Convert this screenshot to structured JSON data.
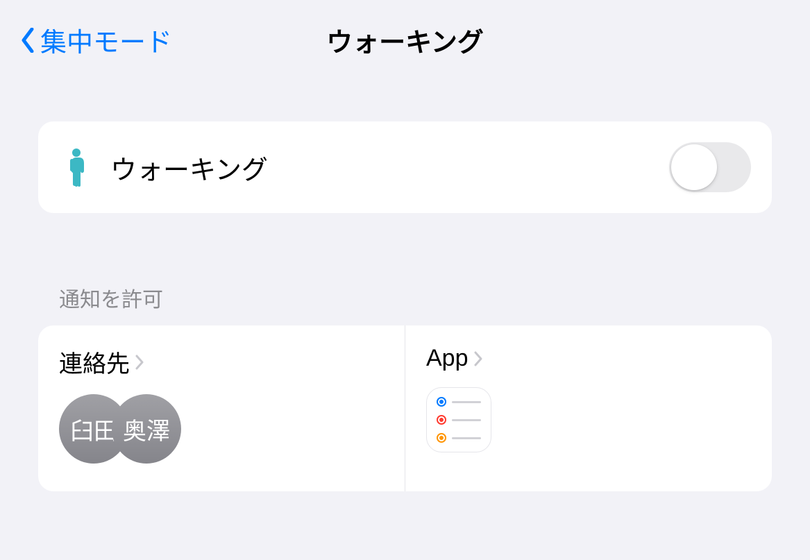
{
  "header": {
    "back_label": "集中モード",
    "title": "ウォーキング"
  },
  "focus": {
    "name": "ウォーキング",
    "enabled": false
  },
  "allow_section": {
    "header": "通知を許可",
    "contacts": {
      "label": "連絡先",
      "avatars": [
        "臼田",
        "奥澤"
      ]
    },
    "apps": {
      "label": "App"
    }
  }
}
